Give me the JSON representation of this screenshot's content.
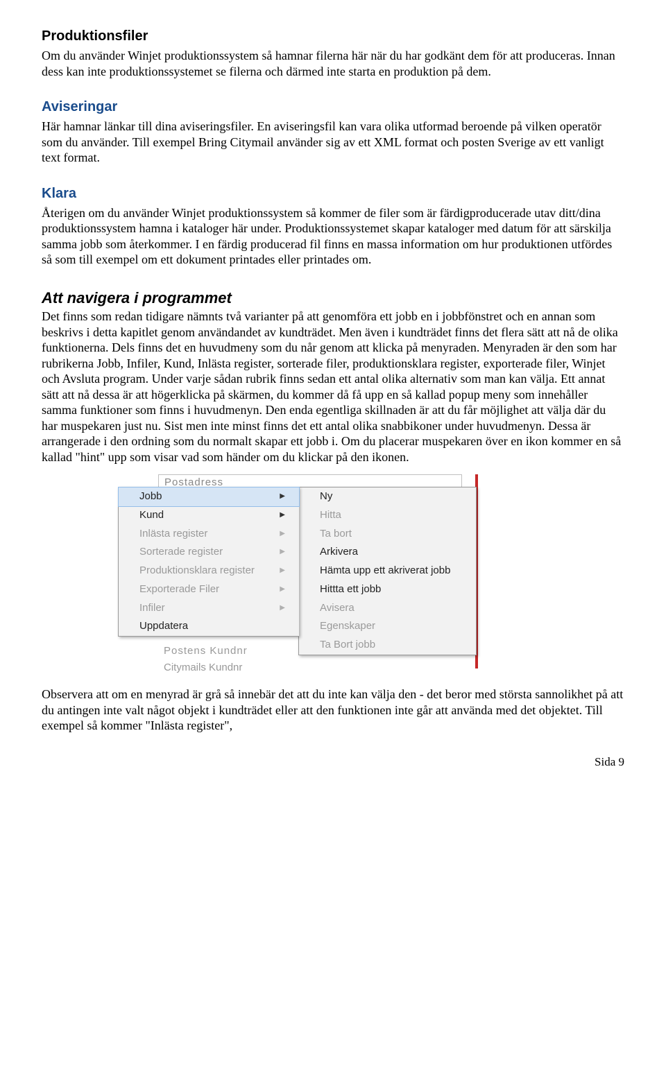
{
  "sections": {
    "prodfiler_h": "Produktionsfiler",
    "prodfiler_p": "Om du använder Winjet produktionssystem så hamnar filerna här när du har godkänt dem för att produceras. Innan dess kan inte produktionssystemet se filerna och därmed inte starta en produktion på dem.",
    "aviseringar_h": "Aviseringar",
    "aviseringar_p": "Här hamnar länkar till dina aviseringsfiler. En aviseringsfil kan vara olika utformad beroende på vilken operatör som du använder. Till exempel Bring Citymail använder sig av ett XML format och posten Sverige av ett vanligt text format.",
    "klara_h": "Klara",
    "klara_p": "Återigen om du använder Winjet produktionssystem så kommer de filer som är färdigproducerade utav ditt/dina produktionssystem hamna i kataloger här under. Produktionssystemet skapar kataloger med datum för att särskilja samma jobb som återkommer. I en färdig producerad fil finns en massa information om hur produktionen utfördes så som till exempel om ett dokument printades eller printades om.",
    "nav_h": "Att navigera i programmet",
    "nav_p": "Det finns som redan tidigare nämnts två varianter på att genomföra ett jobb en i jobbfönstret och en annan som beskrivs i detta kapitlet genom användandet av kundträdet. Men även i kundträdet finns det flera sätt att nå de olika funktionerna. Dels finns det en huvudmeny som du når genom att klicka på menyraden. Menyraden är den som har rubrikerna Jobb, Infiler, Kund, Inlästa register, sorterade filer, produktionsklara register, exporterade filer, Winjet och Avsluta program. Under varje sådan rubrik finns sedan ett antal olika alternativ som man kan välja. Ett annat sätt att nå dessa är att högerklicka på skärmen, du kommer då få upp en så kallad popup meny som innehåller samma funktioner som finns i huvudmenyn. Den enda egentliga skillnaden är att du får möjlighet att välja där du har muspekaren just nu. Sist men inte minst finns det ett antal olika snabbikoner under huvudmenyn. Dessa är arrangerade i den ordning som du normalt skapar ett jobb i. Om du placerar muspekaren över en ikon kommer en så kallad \"hint\" upp som visar vad som händer om du klickar på den ikonen.",
    "after_img_p": "Observera att om en menyrad är grå så innebär det att du inte kan välja den - det beror med största sannolikhet på att du antingen inte valt något objekt i kundträdet eller att den funktionen inte går att använda med det objektet. Till exempel så kommer \"Inlästa register\","
  },
  "bg": {
    "top": "Postadress",
    "mid": "Postens Kundnr",
    "bot": "Citymails Kundnr"
  },
  "menu_left": [
    {
      "label": "Jobb",
      "disabled": false,
      "arrow": true,
      "highlight": true
    },
    {
      "label": "Kund",
      "disabled": false,
      "arrow": true,
      "highlight": false
    },
    {
      "label": "Inlästa register",
      "disabled": true,
      "arrow": true,
      "highlight": false
    },
    {
      "label": "Sorterade register",
      "disabled": true,
      "arrow": true,
      "highlight": false
    },
    {
      "label": "Produktionsklara register",
      "disabled": true,
      "arrow": true,
      "highlight": false
    },
    {
      "label": "Exporterade Filer",
      "disabled": true,
      "arrow": true,
      "highlight": false
    },
    {
      "label": "Infiler",
      "disabled": true,
      "arrow": true,
      "highlight": false
    },
    {
      "label": "Uppdatera",
      "disabled": false,
      "arrow": false,
      "highlight": false
    }
  ],
  "menu_right": [
    {
      "label": "Ny",
      "disabled": false
    },
    {
      "label": "Hitta",
      "disabled": true
    },
    {
      "label": "Ta bort",
      "disabled": true
    },
    {
      "label": "Arkivera",
      "disabled": false
    },
    {
      "label": "Hämta upp ett akriverat jobb",
      "disabled": false
    },
    {
      "label": "Hittta ett jobb",
      "disabled": false
    },
    {
      "label": "Avisera",
      "disabled": true
    },
    {
      "label": "Egenskaper",
      "disabled": true
    },
    {
      "label": "Ta Bort jobb",
      "disabled": true
    }
  ],
  "page_num": "Sida 9"
}
